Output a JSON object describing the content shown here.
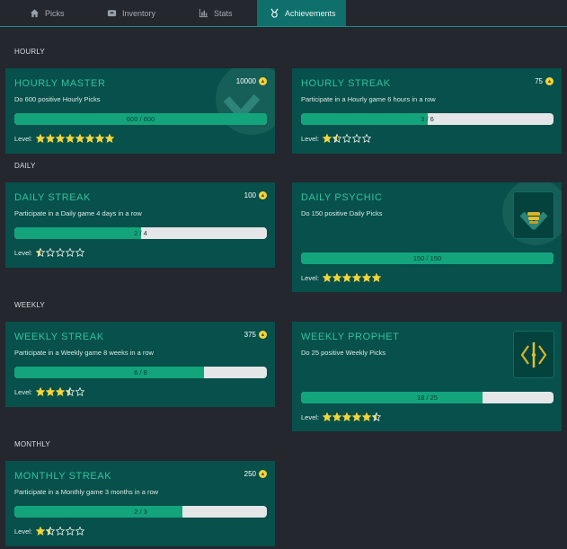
{
  "tabs": [
    {
      "label": "Picks",
      "icon": "home-icon",
      "active": false
    },
    {
      "label": "Inventory",
      "icon": "inventory-icon",
      "active": false
    },
    {
      "label": "Stats",
      "icon": "stats-icon",
      "active": false
    },
    {
      "label": "Achievements",
      "icon": "achievement-icon",
      "active": true
    }
  ],
  "sections": {
    "hourly": "HOURLY",
    "daily": "DAILY",
    "weekly": "WEEKLY",
    "monthly": "MONTHLY"
  },
  "level_label": "Level:",
  "colors": {
    "accent": "#33c29e",
    "card": "#07504b",
    "fill": "#13a47c",
    "star": "#f2d43c"
  },
  "cards": {
    "hourly_master": {
      "title": "HOURLY MASTER",
      "desc": "Do 600 positive Hourly Picks",
      "points": "10000",
      "progress_text": "600 / 600",
      "progress": 1.0,
      "stars": 8,
      "stars_total": 8
    },
    "hourly_streak": {
      "title": "HOURLY STREAK",
      "desc": "Participate in a Hourly game 6 hours in a row",
      "points": "75",
      "progress_text": "3 / 6",
      "progress": 0.5,
      "stars": 1.5,
      "stars_total": 5
    },
    "daily_streak": {
      "title": "DAILY STREAK",
      "desc": "Participate in a Daily game 4 days in a row",
      "points": "100",
      "progress_text": "2 / 4",
      "progress": 0.5,
      "stars": 0.5,
      "stars_total": 5
    },
    "daily_psychic": {
      "title": "DAILY PSYCHIC",
      "desc": "Do 150 positive Daily Picks",
      "points": "",
      "progress_text": "150 / 150",
      "progress": 1.0,
      "stars": 6,
      "stars_total": 6
    },
    "weekly_streak": {
      "title": "WEEKLY STREAK",
      "desc": "Participate in a Weekly game 8 weeks in a row",
      "points": "375",
      "progress_text": "6 / 8",
      "progress": 0.75,
      "stars": 3.5,
      "stars_total": 5
    },
    "weekly_prophet": {
      "title": "WEEKLY PROPHET",
      "desc": "Do 25 positive Weekly Picks",
      "points": "",
      "progress_text": "18 / 25",
      "progress": 0.72,
      "stars": 5.5,
      "stars_total": 6
    },
    "monthly_streak": {
      "title": "MONTHLY STREAK",
      "desc": "Participate in a Monthly game 3 months in a row",
      "points": "250",
      "progress_text": "2 / 3",
      "progress": 0.667,
      "stars": 1.5,
      "stars_total": 5
    }
  }
}
